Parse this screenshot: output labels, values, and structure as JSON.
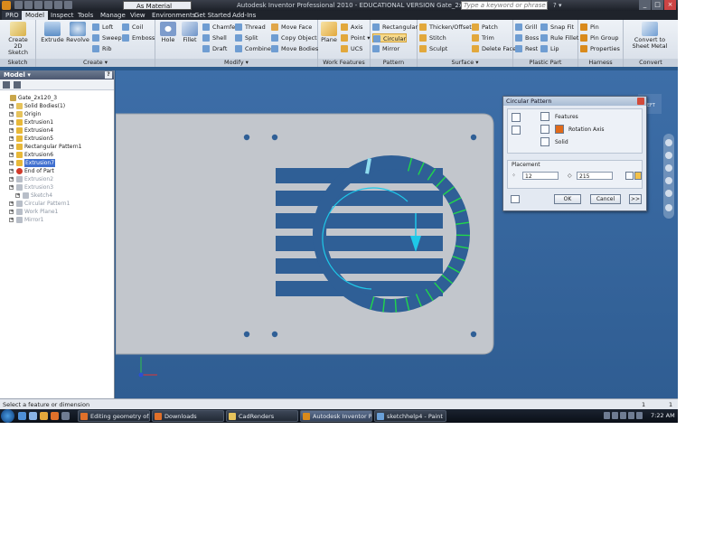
{
  "titlebar": {
    "material": "As Material",
    "window_title": "Autodesk Inventor Professional 2010 - EDUCATIONAL VERSION     Gate_2x120_3",
    "search_placeholder": "Type a keyword or phrase",
    "pro_label": "PRO"
  },
  "tabs": [
    "Model",
    "Inspect",
    "Tools",
    "Manage",
    "View",
    "Environments",
    "Get Started",
    "Add-Ins"
  ],
  "ribbon": {
    "sketch": {
      "label": "Sketch",
      "create_2d": "Create\n2D Sketch"
    },
    "create": {
      "label": "Create",
      "extrude": "Extrude",
      "revolve": "Revolve",
      "loft": "Loft",
      "sweep": "Sweep",
      "rib": "Rib",
      "coil": "Coil",
      "emboss": "Emboss"
    },
    "modify": {
      "label": "Modify",
      "hole": "Hole",
      "fillet": "Fillet",
      "chamfer": "Chamfer",
      "shell": "Shell",
      "draft": "Draft",
      "thread": "Thread",
      "split": "Split",
      "combine": "Combine",
      "move_face": "Move Face",
      "copy_object": "Copy Object",
      "move_bodies": "Move Bodies"
    },
    "work_features": {
      "label": "Work Features",
      "plane": "Plane",
      "axis": "Axis",
      "point": "Point",
      "ucs": "UCS"
    },
    "pattern": {
      "label": "Pattern",
      "rectangular": "Rectangular",
      "circular": "Circular",
      "mirror": "Mirror"
    },
    "surface": {
      "label": "Surface",
      "thicken": "Thicken/Offset",
      "stitch": "Stitch",
      "sculpt": "Sculpt",
      "patch": "Patch",
      "trim": "Trim",
      "delete_face": "Delete Face"
    },
    "plastic_part": {
      "label": "Plastic Part",
      "grill": "Grill",
      "boss": "Boss",
      "rest": "Rest",
      "snap_fit": "Snap Fit",
      "rule_fillet": "Rule Fillet",
      "lip": "Lip"
    },
    "harness": {
      "label": "Harness",
      "pin": "Pin",
      "pin_group": "Pin Group",
      "properties": "Properties"
    },
    "convert": {
      "label": "Convert",
      "to_sheet_metal": "Convert to\nSheet Metal"
    }
  },
  "browser": {
    "title": "Model",
    "help": "?",
    "nodes": [
      {
        "label": "Gate_2x120_3",
        "indent": 0,
        "state": "normal",
        "icon": "part-icon",
        "color": "#c9a64a"
      },
      {
        "label": "Solid Bodies(1)",
        "indent": 1,
        "state": "normal",
        "icon": "folder-icon",
        "color": "#e6c35c"
      },
      {
        "label": "Origin",
        "indent": 1,
        "state": "normal",
        "icon": "folder-icon",
        "color": "#e6c35c"
      },
      {
        "label": "Extrusion1",
        "indent": 1,
        "state": "normal",
        "icon": "extrude-icon",
        "color": "#e8b838"
      },
      {
        "label": "Extrusion4",
        "indent": 1,
        "state": "normal",
        "icon": "extrude-icon",
        "color": "#e8b838"
      },
      {
        "label": "Extrusion5",
        "indent": 1,
        "state": "normal",
        "icon": "extrude-icon",
        "color": "#e8b838"
      },
      {
        "label": "Rectangular Pattern1",
        "indent": 1,
        "state": "normal",
        "icon": "pattern-icon",
        "color": "#e8b838"
      },
      {
        "label": "Extrusion6",
        "indent": 1,
        "state": "normal",
        "icon": "extrude-icon",
        "color": "#e8b838"
      },
      {
        "label": "Extrusion7",
        "indent": 1,
        "state": "selected",
        "icon": "extrude-icon",
        "color": "#e8b838"
      },
      {
        "label": "End of Part",
        "indent": 1,
        "state": "normal",
        "icon": "end-of-part-icon",
        "color": "#d23b2b"
      },
      {
        "label": "Extrusion2",
        "indent": 1,
        "state": "dim",
        "icon": "extrude-icon",
        "color": "#b8bec8"
      },
      {
        "label": "Extrusion3",
        "indent": 1,
        "state": "dim",
        "icon": "extrude-icon",
        "color": "#b8bec8"
      },
      {
        "label": "Sketch4",
        "indent": 2,
        "state": "dim",
        "icon": "sketch-icon",
        "color": "#b8bec8"
      },
      {
        "label": "Circular Pattern1",
        "indent": 1,
        "state": "dim",
        "icon": "pattern-icon",
        "color": "#b8bec8"
      },
      {
        "label": "Work Plane1",
        "indent": 1,
        "state": "dim",
        "icon": "work-plane-icon",
        "color": "#b8bec8"
      },
      {
        "label": "Mirror1",
        "indent": 1,
        "state": "dim",
        "icon": "mirror-icon",
        "color": "#b8bec8"
      }
    ]
  },
  "dialog": {
    "title": "Circular Pattern",
    "features": "Features",
    "rotation_axis": "Rotation Axis",
    "solid": "Solid",
    "placement": "Placement",
    "count": "12",
    "angle": "215",
    "ok": "OK",
    "cancel": "Cancel",
    "more": ">>"
  },
  "viewcube_label": "LEFT",
  "status": {
    "text": "Select a feature or dimension",
    "num1": "1",
    "num2": "1"
  },
  "taskbar": {
    "tasks": [
      {
        "label": "Editing geometry of...",
        "active": false,
        "color": "#e0702a"
      },
      {
        "label": "Downloads",
        "active": false,
        "color": "#e0702a"
      },
      {
        "label": "CadRenders",
        "active": false,
        "color": "#e6c35c"
      },
      {
        "label": "Autodesk Inventor P...",
        "active": true,
        "color": "#d98a1c"
      },
      {
        "label": "sketchhelp4 - Paint",
        "active": false,
        "color": "#6aa0d8"
      }
    ],
    "clock": "7:22 AM"
  },
  "colors": {
    "accent_green": "#21d84a",
    "sketch_cyan": "#1ec8e8",
    "model_face": "#c2c6cc",
    "slot_blue": "#2f5f96",
    "viewport_bg": "#3a6aa3"
  }
}
